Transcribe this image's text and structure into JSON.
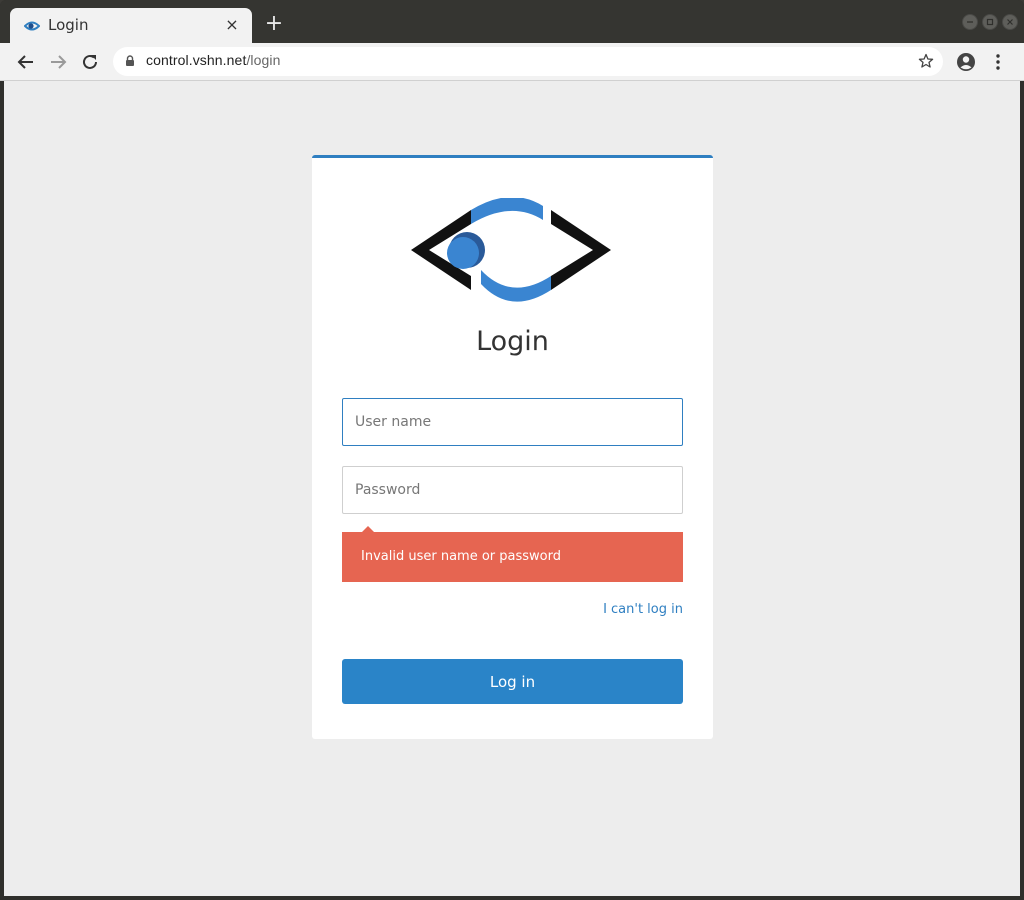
{
  "browser": {
    "tab_title": "Login",
    "tab_close_glyph": "×",
    "new_tab_glyph": "+",
    "url_host": "control.vshn.net",
    "url_path": "/login",
    "icons": [
      "back-arrow-icon",
      "forward-arrow-icon",
      "reload-icon",
      "lock-icon",
      "star-icon",
      "account-icon",
      "menu-kebab-icon",
      "minimize-icon",
      "maximize-icon",
      "close-icon"
    ]
  },
  "page": {
    "title": "Login",
    "username_placeholder": "User name",
    "password_placeholder": "Password",
    "error_message": "Invalid user name or password",
    "cant_login_link": "I can't log in",
    "login_button": "Log in"
  },
  "colors": {
    "accent": "#2f7fc1",
    "button": "#2a84c8",
    "error": "#e66551",
    "background": "#ededed"
  }
}
